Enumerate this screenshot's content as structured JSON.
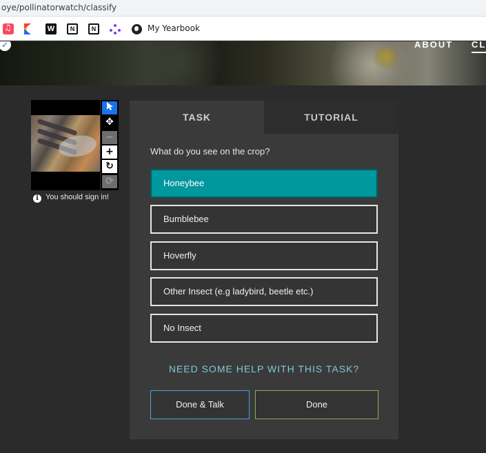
{
  "browser": {
    "url": "oye/pollinatorwatch/classify",
    "bookmarks": [
      {
        "icon": "music-app-icon"
      },
      {
        "icon": "k-app-icon"
      },
      {
        "icon": "w-app-icon",
        "text": "W"
      },
      {
        "icon": "notion-icon",
        "text": "N"
      },
      {
        "icon": "notion-icon",
        "text": "N"
      },
      {
        "icon": "dots-app-icon"
      },
      {
        "icon": "globe-icon",
        "label": "My Yearbook"
      }
    ]
  },
  "nav": {
    "about": "ABOUT",
    "classify": "CLASSIFY"
  },
  "viewer": {
    "signin_text": "You should sign in!",
    "info_glyph": "i",
    "tools": [
      "pointer-icon",
      "move-icon",
      "zoom-out-icon",
      "zoom-in-icon",
      "rotate-icon",
      "reset-icon"
    ]
  },
  "task": {
    "tabs": {
      "task": "TASK",
      "tutorial": "TUTORIAL"
    },
    "question": "What do you see on the crop?",
    "answers": [
      "Honeybee",
      "Bumblebee",
      "Hoverfly",
      "Other Insect (e.g ladybird, beetle etc.)",
      "No Insect"
    ],
    "selected_answer": "Honeybee",
    "help_link": "NEED SOME HELP WITH THIS TASK?",
    "done_talk": "Done & Talk",
    "done": "Done"
  },
  "colors": {
    "selected": "#00979d",
    "talk_border": "#43a6db",
    "done_border": "#8fad4e",
    "help_text": "#7fcbd6"
  }
}
